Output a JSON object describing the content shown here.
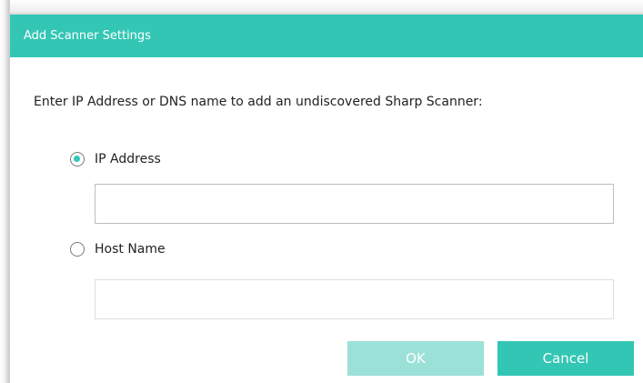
{
  "dialog": {
    "title": "Add Scanner Settings",
    "instruction": "Enter IP Address or DNS name to add an undiscovered Sharp Scanner:",
    "accent_color": "#33c6b4",
    "options": [
      {
        "label": "IP Address",
        "selected": true,
        "value": ""
      },
      {
        "label": "Host Name",
        "selected": false,
        "value": ""
      }
    ],
    "buttons": {
      "ok_label": "OK",
      "ok_enabled": false,
      "cancel_label": "Cancel"
    }
  }
}
